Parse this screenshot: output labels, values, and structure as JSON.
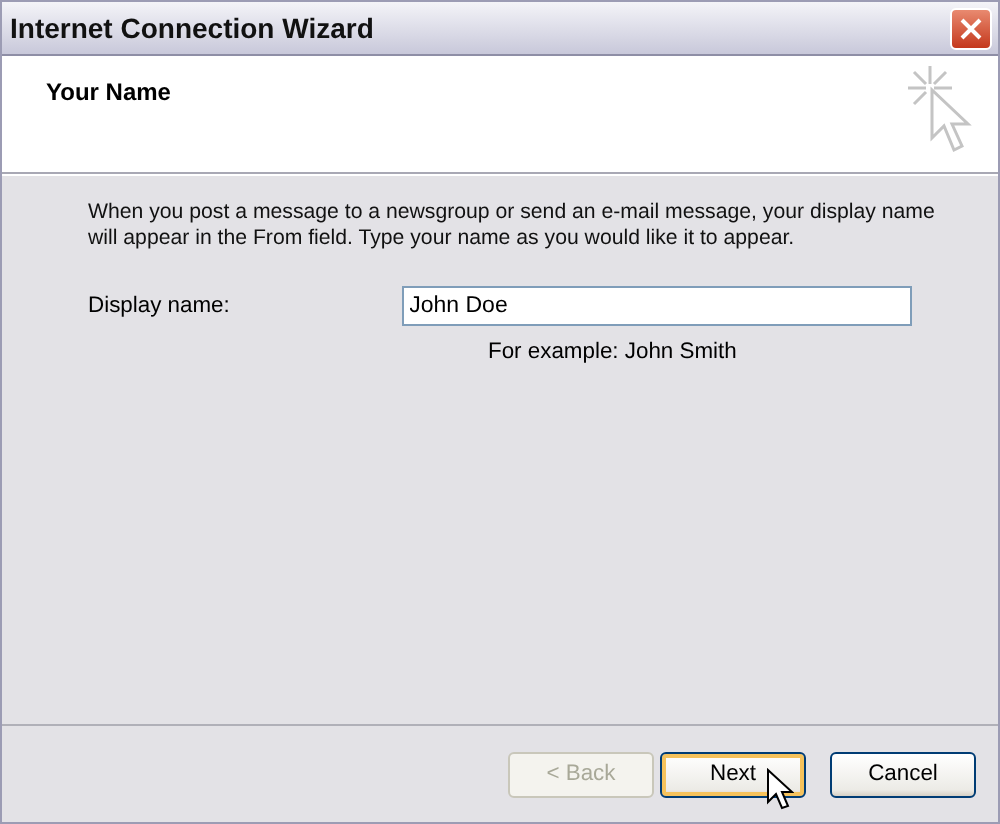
{
  "window": {
    "title": "Internet Connection Wizard"
  },
  "header": {
    "title": "Your Name"
  },
  "intro": "When you post a message to a newsgroup or send an e-mail message, your display name will appear in the From field.  Type your name as you would like it to appear.",
  "display_name": {
    "label": "Display name:",
    "value": "John Doe",
    "example": "For example: John Smith"
  },
  "buttons": [
    {
      "label": "< Back",
      "disabled": true,
      "focused": false
    },
    {
      "label": "Next",
      "disabled": false,
      "focused": true
    },
    {
      "label": "Cancel",
      "disabled": false,
      "focused": false
    }
  ]
}
